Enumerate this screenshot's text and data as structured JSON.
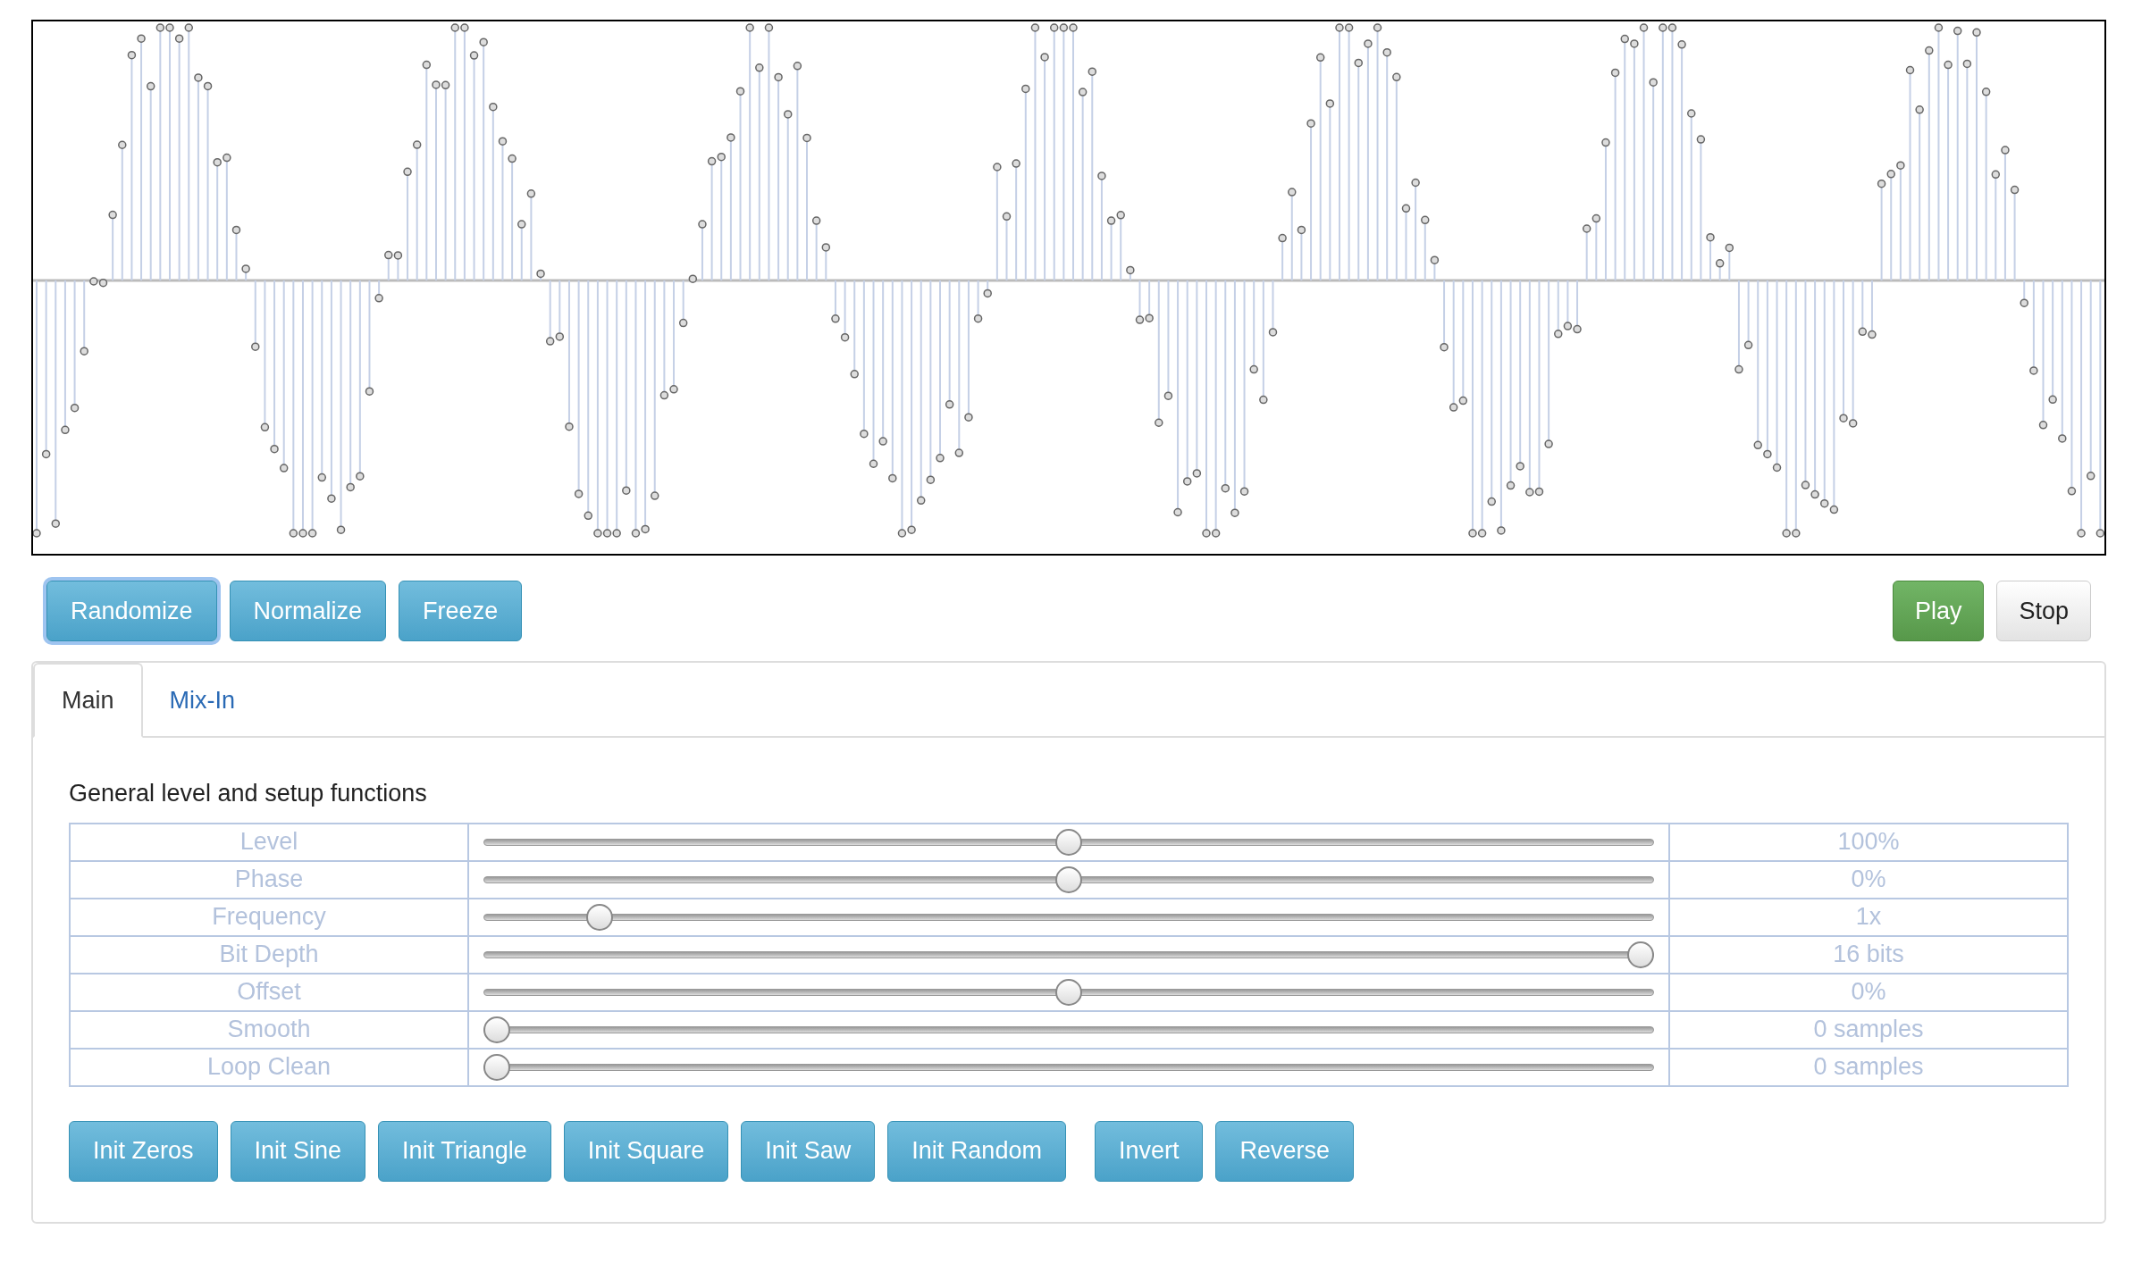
{
  "toolbar": {
    "left_buttons": [
      {
        "label": "Randomize",
        "focused": true
      },
      {
        "label": "Normalize",
        "focused": false
      },
      {
        "label": "Freeze",
        "focused": false
      }
    ],
    "right_buttons": [
      {
        "label": "Play",
        "kind": "success"
      },
      {
        "label": "Stop",
        "kind": "default"
      }
    ]
  },
  "tabs": [
    {
      "label": "Main",
      "selected": true
    },
    {
      "label": "Mix-In",
      "selected": false
    }
  ],
  "section_title": "General level and setup functions",
  "parameters": [
    {
      "name": "Level",
      "level": 0.5,
      "reading": "100%"
    },
    {
      "name": "Phase",
      "level": 0.5,
      "reading": "0%"
    },
    {
      "name": "Frequency",
      "level": 0.09,
      "reading": "1x"
    },
    {
      "name": "Bit Depth",
      "level": 1,
      "reading": "16 bits"
    },
    {
      "name": "Offset",
      "level": 0.5,
      "reading": "0%"
    },
    {
      "name": "Smooth",
      "level": 0,
      "reading": "0 samples"
    },
    {
      "name": "Loop Clean",
      "level": 0,
      "reading": "0 samples"
    }
  ],
  "init_buttons": [
    "Init Zeros",
    "Init Sine",
    "Init Triangle",
    "Init Square",
    "Init Saw",
    "Init Random"
  ],
  "transform_buttons": [
    "Invert",
    "Reverse"
  ]
}
